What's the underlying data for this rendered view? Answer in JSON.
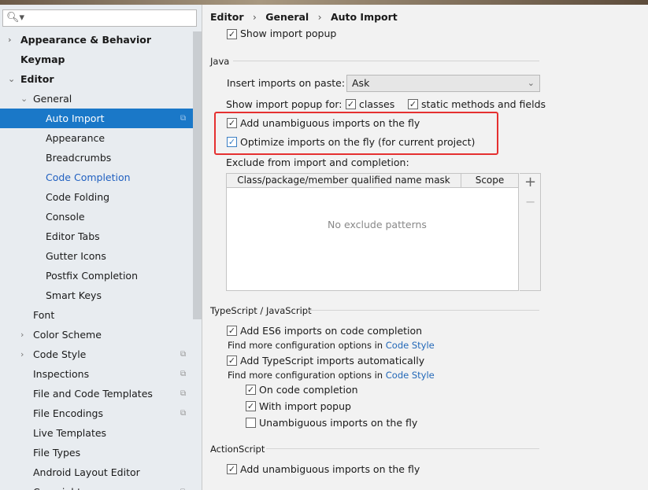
{
  "sidebar": {
    "search_placeholder": "",
    "items": [
      {
        "label": "Appearance & Behavior",
        "level": 0,
        "arrow": "right",
        "bold": true
      },
      {
        "label": "Keymap",
        "level": 0,
        "bold": true
      },
      {
        "label": "Editor",
        "level": 0,
        "arrow": "down",
        "bold": true
      },
      {
        "label": "General",
        "level": 1,
        "arrow": "down"
      },
      {
        "label": "Auto Import",
        "level": 2,
        "selected": true,
        "copy_icon": true
      },
      {
        "label": "Appearance",
        "level": 2
      },
      {
        "label": "Breadcrumbs",
        "level": 2
      },
      {
        "label": "Code Completion",
        "level": 2,
        "link": true
      },
      {
        "label": "Code Folding",
        "level": 2
      },
      {
        "label": "Console",
        "level": 2
      },
      {
        "label": "Editor Tabs",
        "level": 2
      },
      {
        "label": "Gutter Icons",
        "level": 2
      },
      {
        "label": "Postfix Completion",
        "level": 2
      },
      {
        "label": "Smart Keys",
        "level": 2
      },
      {
        "label": "Font",
        "level": 1
      },
      {
        "label": "Color Scheme",
        "level": 1,
        "arrow": "right"
      },
      {
        "label": "Code Style",
        "level": 1,
        "arrow": "right",
        "copy_icon": true
      },
      {
        "label": "Inspections",
        "level": 1,
        "copy_icon": true
      },
      {
        "label": "File and Code Templates",
        "level": 1,
        "copy_icon": true
      },
      {
        "label": "File Encodings",
        "level": 1,
        "copy_icon": true
      },
      {
        "label": "Live Templates",
        "level": 1
      },
      {
        "label": "File Types",
        "level": 1
      },
      {
        "label": "Android Layout Editor",
        "level": 1
      },
      {
        "label": "Copyright",
        "level": 1,
        "arrow": "right",
        "copy_icon": true
      }
    ]
  },
  "breadcrumb": [
    "Editor",
    "General",
    "Auto Import"
  ],
  "general": {
    "show_import_popup": {
      "label": "Show import popup",
      "checked": true
    }
  },
  "java": {
    "title": "Java",
    "insert_label": "Insert imports on paste:",
    "insert_value": "Ask",
    "popup_for_label": "Show import popup for:",
    "classes": {
      "label": "classes",
      "checked": true
    },
    "static": {
      "label": "static methods and fields",
      "checked": true
    },
    "add_unambiguous": {
      "label": "Add unambiguous imports on the fly",
      "checked": true
    },
    "optimize": {
      "label": "Optimize imports on the fly (for current project)",
      "checked": true
    },
    "exclude_label": "Exclude from import and completion:",
    "table": {
      "columns": [
        "Class/package/member qualified name mask",
        "Scope"
      ],
      "empty": "No exclude patterns",
      "add": "+",
      "remove": "−"
    }
  },
  "ts": {
    "title": "TypeScript / JavaScript",
    "es6": {
      "label": "Add ES6 imports on code completion",
      "checked": true
    },
    "more1": "Find more configuration options in ",
    "link": "Code Style",
    "ts_auto": {
      "label": "Add TypeScript imports automatically",
      "checked": true
    },
    "more2": "Find more configuration options in ",
    "on_completion": {
      "label": "On code completion",
      "checked": true
    },
    "with_popup": {
      "label": "With import popup",
      "checked": true
    },
    "unambiguous": {
      "label": "Unambiguous imports on the fly",
      "checked": false
    }
  },
  "as": {
    "title": "ActionScript",
    "add_unambiguous": {
      "label": "Add unambiguous imports on the fly",
      "checked": true
    }
  },
  "colors": {
    "selection": "#1a78c8",
    "highlight": "#e53030",
    "link": "#2268b8"
  }
}
